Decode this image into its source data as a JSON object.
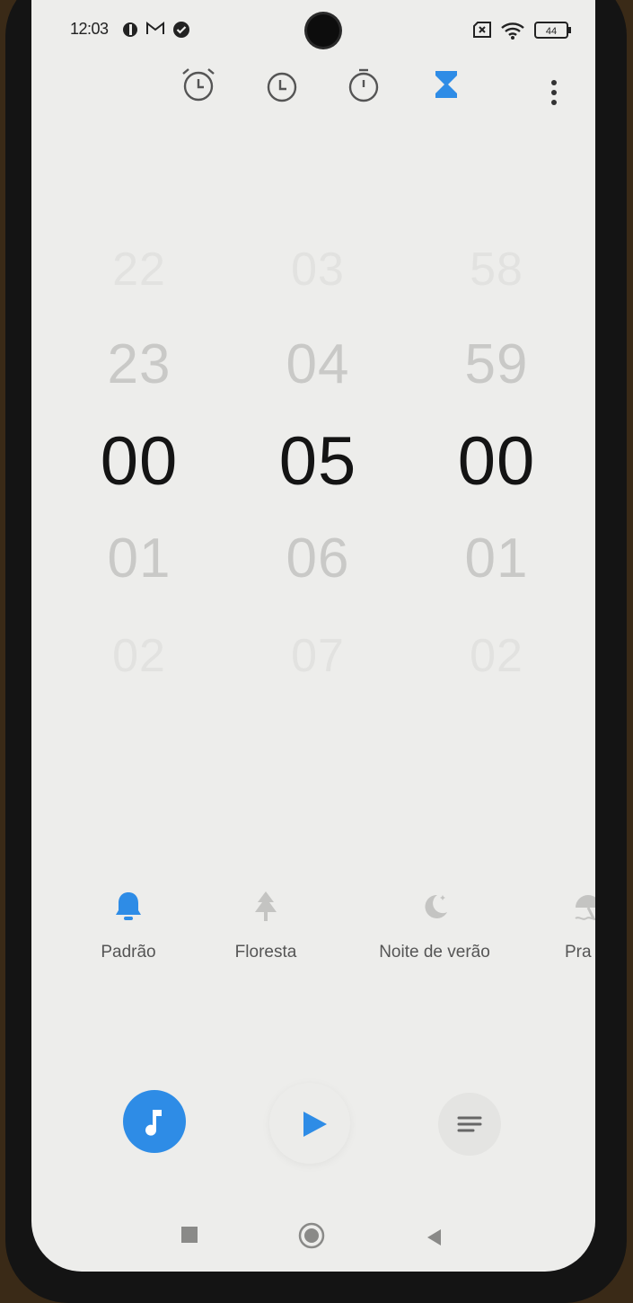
{
  "status_bar": {
    "time": "12:03",
    "icons": [
      "notification-app-icon",
      "gmail-icon",
      "check-circle-icon",
      "sim-blocked-icon",
      "wifi-icon"
    ],
    "battery_level": "44"
  },
  "tabs": [
    {
      "name": "alarm",
      "icon": "alarm-clock-icon",
      "active": false
    },
    {
      "name": "clock",
      "icon": "clock-icon",
      "active": false
    },
    {
      "name": "stopwatch",
      "icon": "stopwatch-icon",
      "active": false
    },
    {
      "name": "timer",
      "icon": "hourglass-icon",
      "active": true
    }
  ],
  "accent_color": "#2e8ce6",
  "picker": {
    "hours": {
      "prev2": "22",
      "prev": "23",
      "selected": "00",
      "next": "01",
      "next2": "02"
    },
    "minutes": {
      "prev2": "03",
      "prev": "04",
      "selected": "05",
      "next": "06",
      "next2": "07"
    },
    "seconds": {
      "prev2": "58",
      "prev": "59",
      "selected": "00",
      "next": "01",
      "next2": "02"
    }
  },
  "sounds": [
    {
      "label": "Padrão",
      "icon": "bell-icon",
      "selected": true
    },
    {
      "label": "Floresta",
      "icon": "tree-icon",
      "selected": false
    },
    {
      "label": "Noite de verão",
      "icon": "moon-icon",
      "selected": false
    },
    {
      "label": "Pra",
      "icon": "umbrella-beach-icon",
      "selected": false
    }
  ],
  "controls": {
    "music": "music-note-icon",
    "start": "play-icon",
    "presets": "list-icon"
  },
  "nav_bar": [
    "recents-square-icon",
    "home-circle-icon",
    "back-triangle-icon"
  ]
}
